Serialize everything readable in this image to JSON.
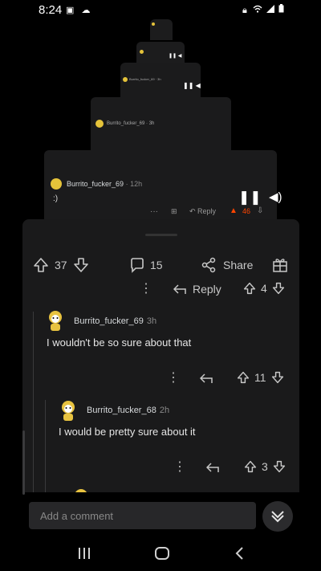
{
  "status_bar": {
    "time": "8:24",
    "left_icons": [
      "screenshot-icon",
      "cloud-icon"
    ],
    "right_icons": [
      "lock-icon",
      "wifi-icon",
      "signal-icon",
      "battery-icon"
    ]
  },
  "stack_cards": [
    {
      "author": "Burrito_fucker_69",
      "age": "12h",
      "body": ":)",
      "reply": "Reply",
      "score": "46"
    },
    {
      "author": "Burrito_fucker_69",
      "age": "3h"
    }
  ],
  "post_bar": {
    "score": "37",
    "comments_count": "15",
    "share_label": "Share"
  },
  "reply_bar": {
    "reply_label": "Reply",
    "score": "4"
  },
  "comments": [
    {
      "author": "Burrito_fucker_69",
      "age": "3h",
      "body": "I wouldn't be so sure about that",
      "score": "11"
    },
    {
      "author": "Burrito_fucker_68",
      "age": "2h",
      "body": "I would be pretty sure about it",
      "score": "3"
    }
  ],
  "comment_input": {
    "placeholder": "Add a comment"
  },
  "colors": {
    "accent_upvote": "#ff4500",
    "background": "#000000",
    "card": "#1a1a1b"
  }
}
